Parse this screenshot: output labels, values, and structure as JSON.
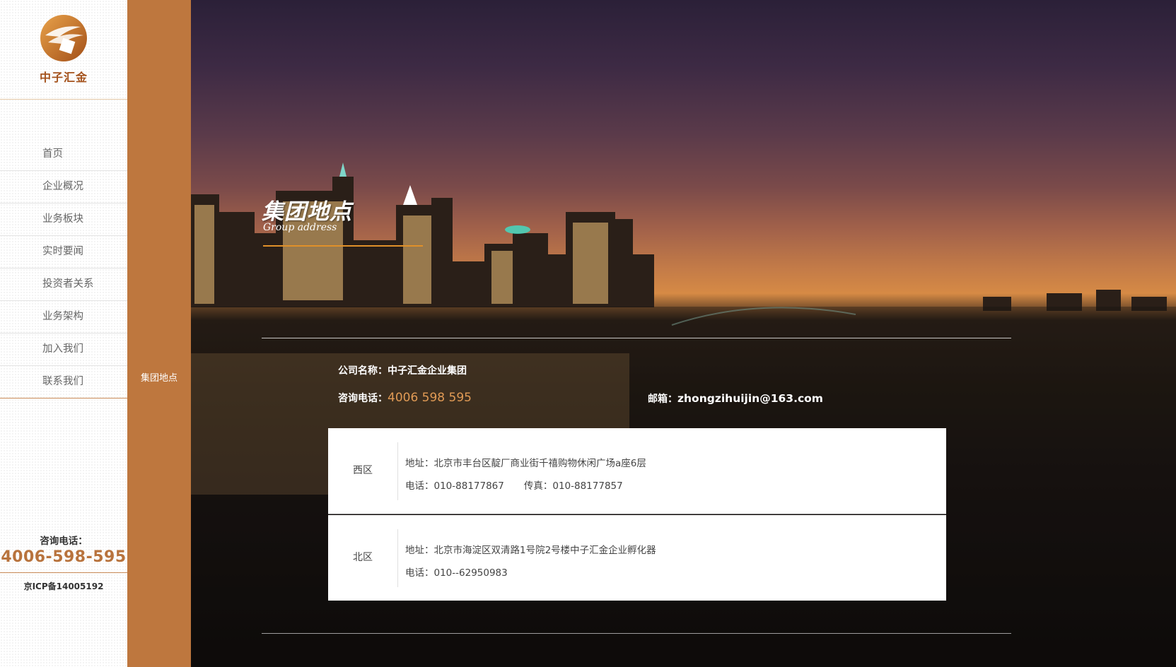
{
  "brand": {
    "name": "中子汇金"
  },
  "nav": {
    "items": [
      {
        "label": "首页"
      },
      {
        "label": "企业概况"
      },
      {
        "label": "业务板块"
      },
      {
        "label": "实时要闻"
      },
      {
        "label": "投资者关系"
      },
      {
        "label": "业务架构"
      },
      {
        "label": "加入我们"
      },
      {
        "label": "联系我们"
      }
    ]
  },
  "sidebar_contact": {
    "label": "咨询电话：",
    "phone": "4006-598-595",
    "icp": "京ICP备14005192"
  },
  "subnav": {
    "active_label": "集团地点"
  },
  "page": {
    "title_cn": "集团地点",
    "title_en": "Group address"
  },
  "info": {
    "company_label": "公司名称：",
    "company_name": "中子汇金企业集团",
    "consult_label": "咨询电话：",
    "consult_phone": "4006 598 595",
    "email_label": "邮箱：",
    "email": "zhongzihuijin@163.com"
  },
  "locations": [
    {
      "region": "西区",
      "address": "地址：北京市丰台区靛厂商业街千禧购物休闲广场a座6层",
      "phone": "电话：010-88177867",
      "fax": "传真：010-88177857"
    },
    {
      "region": "北区",
      "address": "地址：北京市海淀区双清路1号院2号楼中子汇金企业孵化器",
      "phone": "电话：010--62950983"
    }
  ],
  "colors": {
    "accent": "#be773e",
    "brand_text": "#a4521c",
    "title_underline": "#e0902a"
  }
}
